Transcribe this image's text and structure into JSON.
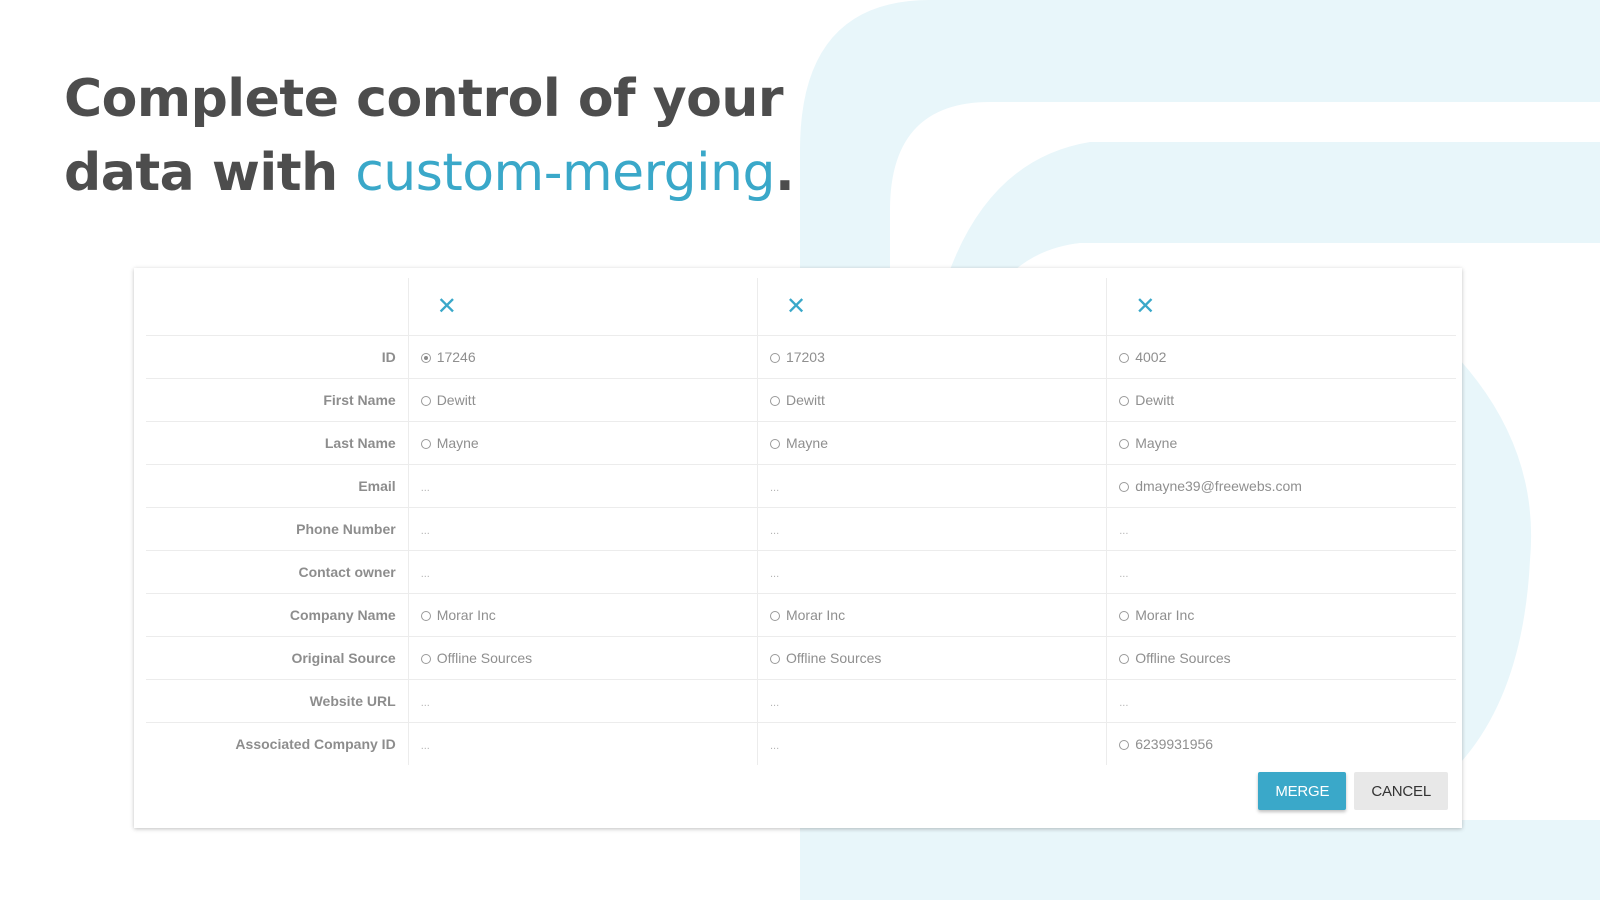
{
  "headline": {
    "line1": "Complete control of your",
    "line2_prefix": "data with ",
    "line2_accent": "custom-merging",
    "line2_suffix": "."
  },
  "colors": {
    "accent": "#3aa8c9",
    "text_dark": "#4d4d4d",
    "bg_shape": "#e8f6fa",
    "cancel_bg": "#e8e8e8"
  },
  "merge_table": {
    "columns": [
      {
        "remove_icon": "close-icon"
      },
      {
        "remove_icon": "close-icon"
      },
      {
        "remove_icon": "close-icon"
      }
    ],
    "rows": [
      {
        "label": "ID",
        "cells": [
          {
            "value": "17246",
            "radio": true,
            "checked": true
          },
          {
            "value": "17203",
            "radio": true,
            "checked": false
          },
          {
            "value": "4002",
            "radio": true,
            "checked": false
          }
        ]
      },
      {
        "label": "First Name",
        "cells": [
          {
            "value": "Dewitt",
            "radio": true,
            "checked": false
          },
          {
            "value": "Dewitt",
            "radio": true,
            "checked": false
          },
          {
            "value": "Dewitt",
            "radio": true,
            "checked": false
          }
        ]
      },
      {
        "label": "Last Name",
        "cells": [
          {
            "value": "Mayne",
            "radio": true,
            "checked": false
          },
          {
            "value": "Mayne",
            "radio": true,
            "checked": false
          },
          {
            "value": "Mayne",
            "radio": true,
            "checked": false
          }
        ]
      },
      {
        "label": "Email",
        "cells": [
          {
            "value": "...",
            "radio": false
          },
          {
            "value": "...",
            "radio": false
          },
          {
            "value": "dmayne39@freewebs.com",
            "radio": true,
            "checked": false
          }
        ]
      },
      {
        "label": "Phone Number",
        "cells": [
          {
            "value": "...",
            "radio": false
          },
          {
            "value": "...",
            "radio": false
          },
          {
            "value": "...",
            "radio": false
          }
        ]
      },
      {
        "label": "Contact owner",
        "cells": [
          {
            "value": "...",
            "radio": false
          },
          {
            "value": "...",
            "radio": false
          },
          {
            "value": "...",
            "radio": false
          }
        ]
      },
      {
        "label": "Company Name",
        "cells": [
          {
            "value": "Morar Inc",
            "radio": true,
            "checked": false
          },
          {
            "value": "Morar Inc",
            "radio": true,
            "checked": false
          },
          {
            "value": "Morar Inc",
            "radio": true,
            "checked": false
          }
        ]
      },
      {
        "label": "Original Source",
        "cells": [
          {
            "value": "Offline Sources",
            "radio": true,
            "checked": false
          },
          {
            "value": "Offline Sources",
            "radio": true,
            "checked": false
          },
          {
            "value": "Offline Sources",
            "radio": true,
            "checked": false
          }
        ]
      },
      {
        "label": "Website URL",
        "cells": [
          {
            "value": "...",
            "radio": false
          },
          {
            "value": "...",
            "radio": false
          },
          {
            "value": "...",
            "radio": false
          }
        ]
      },
      {
        "label": "Associated Company ID",
        "cells": [
          {
            "value": "...",
            "radio": false
          },
          {
            "value": "...",
            "radio": false
          },
          {
            "value": "6239931956",
            "radio": true,
            "checked": false
          }
        ]
      }
    ]
  },
  "buttons": {
    "merge": "MERGE",
    "cancel": "CANCEL"
  }
}
